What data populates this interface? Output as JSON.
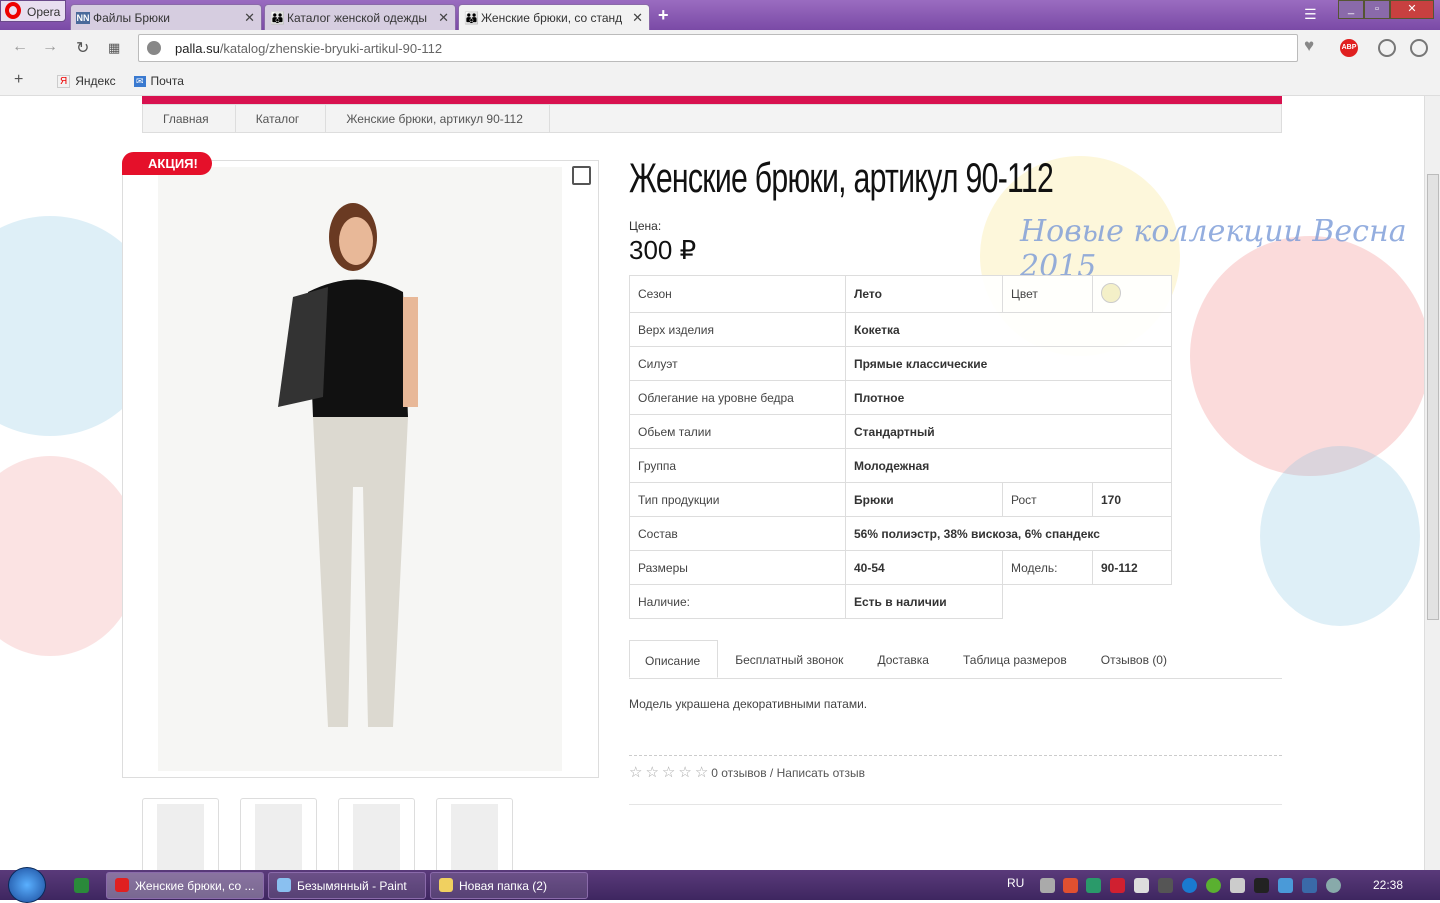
{
  "browser": {
    "name": "Opera",
    "tabs": [
      {
        "label": "Файлы Брюки",
        "icon": "NN"
      },
      {
        "label": "Каталог женской одежды",
        "icon": "people-icon"
      },
      {
        "label": "Женские брюки, со станд",
        "icon": "people-icon"
      }
    ],
    "url_domain": "palla.su",
    "url_path": "/katalog/zhenskie-bryuki-artikul-90-112",
    "bookmarks": [
      "Яндекс",
      "Почта"
    ],
    "abp": "ABP"
  },
  "breadcrumbs": [
    "Главная",
    "Каталог",
    "Женские брюки, артикул 90-112"
  ],
  "product": {
    "sale_badge": "АКЦИЯ!",
    "title": "Женские брюки, артикул 90-112",
    "price_label": "Цена:",
    "price": "300 ₽",
    "promo": "Новые коллекции Весна 2015",
    "specs": [
      {
        "label": "Сезон",
        "value": "Лето",
        "label2": "Цвет",
        "value2": ""
      },
      {
        "label": "Верх изделия",
        "value": "Кокетка"
      },
      {
        "label": "Силуэт",
        "value": "Прямые классические"
      },
      {
        "label": "Облегание на уровне бедра",
        "value": "Плотное"
      },
      {
        "label": "Обьем талии",
        "value": "Стандартный"
      },
      {
        "label": "Группа",
        "value": "Молодежная"
      },
      {
        "label": "Тип продукции",
        "value": "Брюки",
        "label2": "Рост",
        "value2": "170"
      },
      {
        "label": "Состав",
        "value": "56% полиэстр, 38% вискоза, 6% спандекс"
      },
      {
        "label": "Размеры",
        "value": "40-54",
        "label2": "Модель:",
        "value2": "90-112"
      },
      {
        "label": "Наличие:",
        "value": "Есть в наличии"
      }
    ],
    "color_swatch": "#f4f0c8",
    "tabs": [
      "Описание",
      "Бесплатный звонок",
      "Доставка",
      "Таблица размеров",
      "Отзывов (0)"
    ],
    "description": "Модель украшена декоративными патами.",
    "reviews": {
      "rating": 0,
      "max": 5,
      "text": "0 отзывов / Написать отзыв"
    }
  },
  "taskbar": {
    "items": [
      "Женские брюки, со ...",
      "Безымянный - Paint",
      "Новая папка (2)"
    ],
    "lang": "RU",
    "time": "22:38"
  }
}
